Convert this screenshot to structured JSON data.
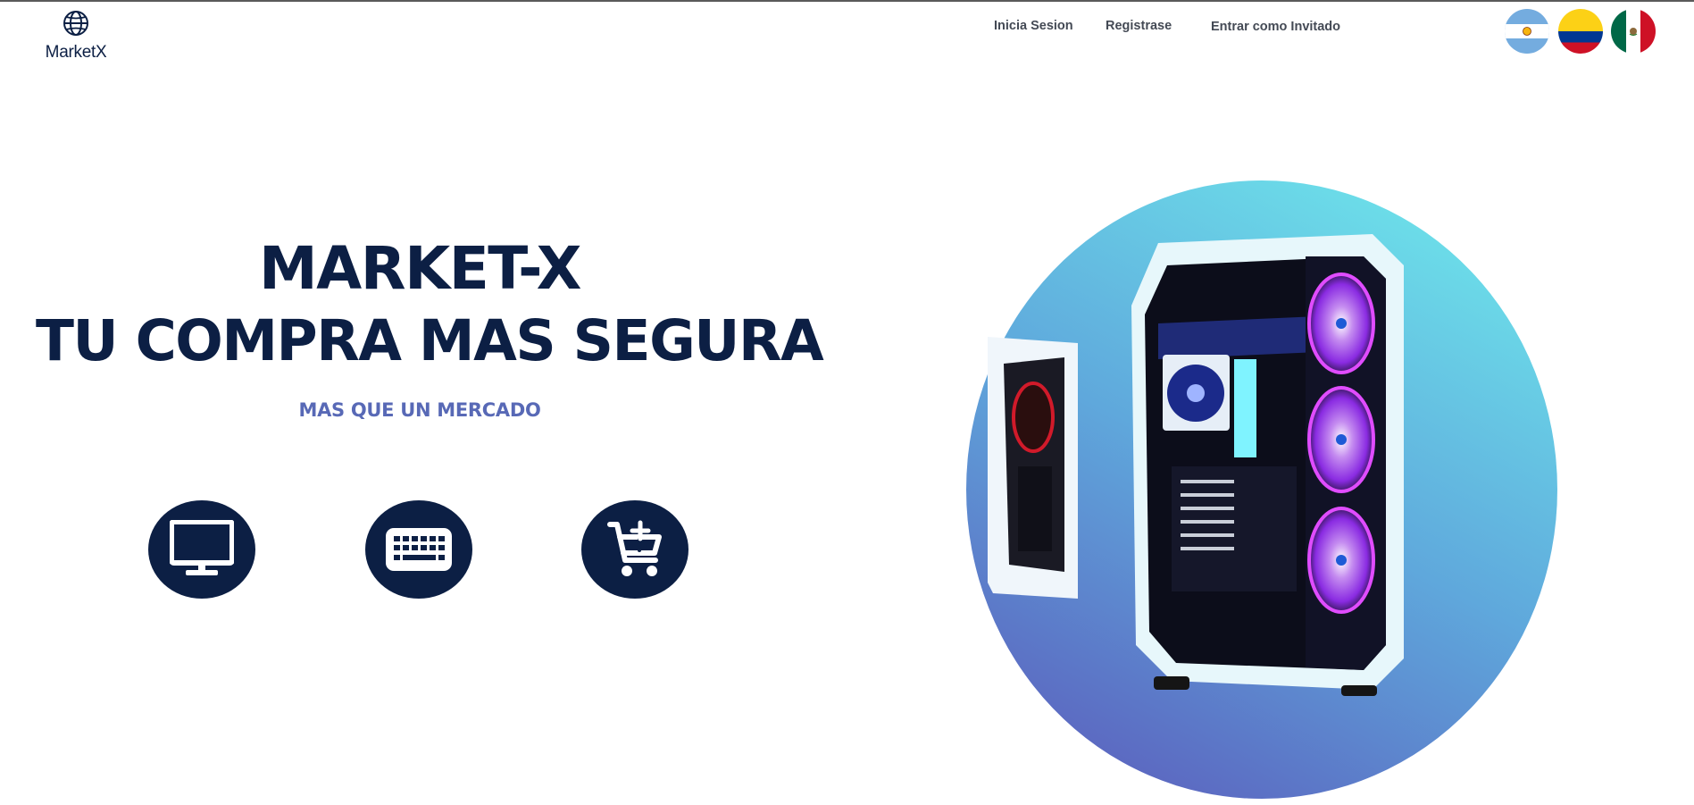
{
  "brand": {
    "name": "MarketX",
    "logo_icon": "globe-icon"
  },
  "nav": {
    "login": "Inicia Sesion",
    "register": "Registrase",
    "guest": "Entrar como Invitado"
  },
  "flags": [
    {
      "country": "Argentina",
      "icon": "argentina-flag-icon"
    },
    {
      "country": "Colombia",
      "icon": "colombia-flag-icon"
    },
    {
      "country": "Mexico",
      "icon": "mexico-flag-icon"
    }
  ],
  "hero": {
    "title_line1": "MARKET-X",
    "title_line2": "TU COMPRA MAS SEGURA",
    "subtitle": "MAS QUE UN MERCADO"
  },
  "categories": [
    {
      "icon": "monitor-icon"
    },
    {
      "icon": "keyboard-icon"
    },
    {
      "icon": "cart-add-icon"
    }
  ],
  "colors": {
    "primary": "#0c1f44",
    "accent": "#5869b6",
    "circle_top": "#6de2ea",
    "circle_bottom": "#5b63bf"
  }
}
